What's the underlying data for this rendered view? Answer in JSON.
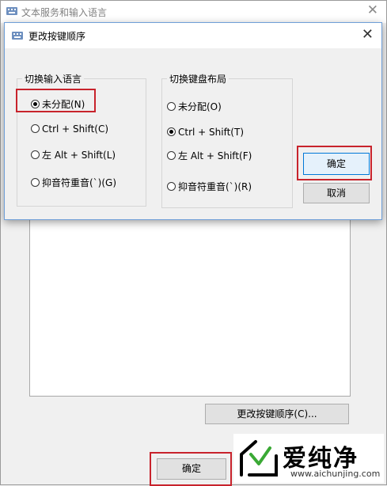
{
  "outer": {
    "title": "文本服务和输入语言",
    "close_glyph": "✕",
    "change_order_label": "更改按键顺序(C)...",
    "ok_label": "确定"
  },
  "dialog": {
    "title": "更改按键顺序",
    "close_glyph": "✕",
    "ok_label": "确定",
    "cancel_label": "取消",
    "left_group": {
      "legend": "切换输入语言",
      "options": [
        "未分配(N)",
        "Ctrl + Shift(C)",
        "左 Alt + Shift(L)",
        "抑音符重音(`)(G)"
      ],
      "selected": 0
    },
    "right_group": {
      "legend": "切换键盘布局",
      "options": [
        "未分配(O)",
        "Ctrl + Shift(T)",
        "左 Alt + Shift(F)",
        "抑音符重音(`)(R)"
      ],
      "selected": 1
    }
  },
  "watermark": {
    "name": "爱纯净",
    "url": "www.aichunjing.com"
  },
  "colors": {
    "highlight": "#c8232c",
    "focus": "#0078d7"
  }
}
